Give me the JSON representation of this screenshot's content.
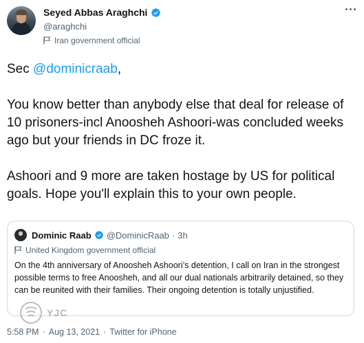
{
  "author": {
    "display_name": "Seyed Abbas Araghchi",
    "handle": "@araghchi",
    "label": "Iran government official"
  },
  "tweet": {
    "greeting_prefix": "Sec ",
    "mention": "@dominicraab",
    "greeting_suffix": ",",
    "paragraph_1": "You know better than anybody else that deal for release of 10 prisoners-incl Anoosheh Ashoori-was concluded weeks ago but your friends in DC froze it.",
    "paragraph_2": "Ashoori and 9 more are taken hostage by US for political goals. Hope you'll explain this to your own people."
  },
  "quote": {
    "display_name": "Dominic Raab",
    "handle": "@DominicRaab",
    "separator": "·",
    "time": "3h",
    "label": "United Kingdom government official",
    "text": "On the 4th anniversary of Anoosheh Ashoori’s detention, I call on Iran in the strongest possible terms to free Anoosheh, and all our dual nationals arbitrarily detained, so they can be reunited with their families. Their ongoing detention is totally unjustified."
  },
  "meta": {
    "time": "5:58 PM",
    "separator": "·",
    "date": "Aug 13, 2021",
    "source": "Twitter for iPhone"
  },
  "watermark": {
    "text": "YJC"
  },
  "colors": {
    "accent": "#1d9bf0",
    "secondary_text": "#536471",
    "border": "#cfd9de"
  },
  "icons": [
    "verified-badge-icon",
    "flag-icon",
    "more-options-icon"
  ]
}
